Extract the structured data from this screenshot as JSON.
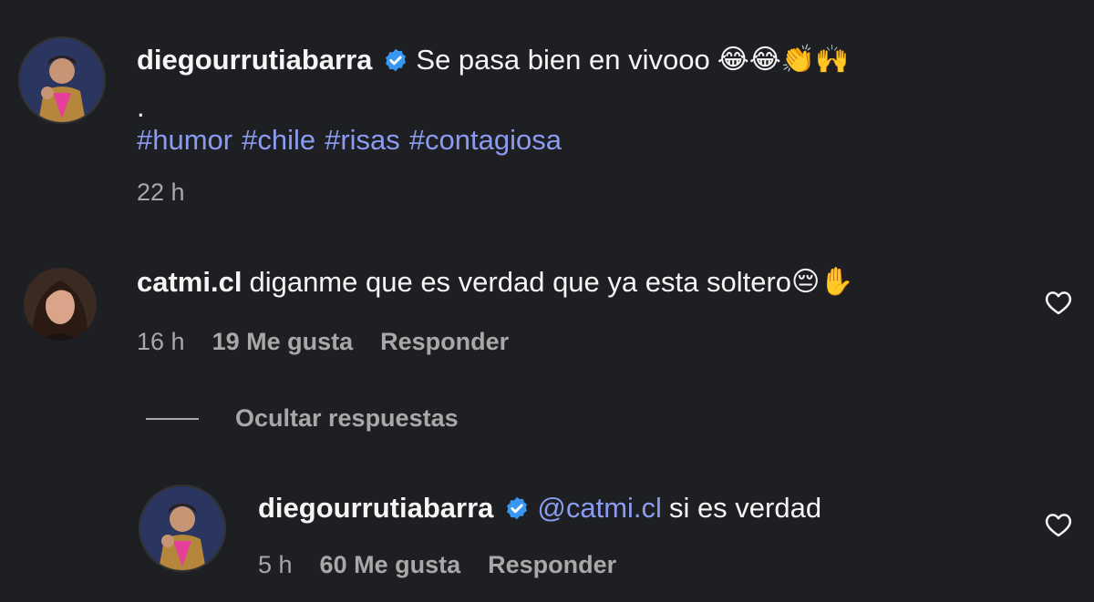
{
  "post": {
    "username": "diegourrutiabarra",
    "verified": true,
    "caption": "Se pasa bien en vivooo",
    "caption_emoji": "😂😂👏🙌",
    "dot": ".",
    "hashtags": [
      "#humor",
      "#chile",
      "#risas",
      "#contagiosa"
    ],
    "time": "22 h"
  },
  "comment": {
    "username": "catmi.cl",
    "text": "diganme que es verdad que ya esta soltero",
    "emoji": "😔✋",
    "time": "16 h",
    "likes": "19 Me gusta",
    "reply_label": "Responder"
  },
  "hide_replies_label": "Ocultar respuestas",
  "reply": {
    "username": "diegourrutiabarra",
    "verified": true,
    "mention": "@catmi.cl",
    "text": "si es verdad",
    "time": "5 h",
    "likes": "60 Me gusta",
    "reply_label": "Responder"
  },
  "colors": {
    "background": "#1e1f23",
    "link": "#8a9bf0",
    "verified": "#3897f0",
    "muted": "#a8a8a8"
  }
}
